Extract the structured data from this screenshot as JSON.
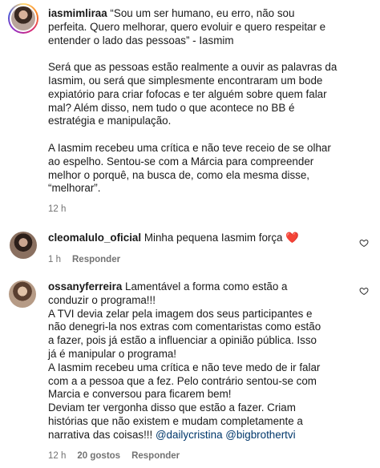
{
  "comments": [
    {
      "username": "iasmimliraa",
      "lines": [
        " “Sou um ser humano, eu erro, não sou",
        "perfeita. Quero melhorar, quero evoluir e quero respeitar e",
        "entender o lado das pessoas” - Iasmim",
        "",
        "Será que as pessoas estão realmente a ouvir as palavras da",
        "Iasmim, ou será que simplesmente encontraram um bode",
        "expiatório para criar fofocas e ter alguém sobre quem falar",
        "mal? Além disso, nem tudo o que acontece no BB é",
        "estratégia e manipulação.",
        "",
        "A Iasmim recebeu uma crítica e não teve receio de se olhar",
        "ao espelho. Sentou-se com a Márcia para compreender",
        "melhor o porquê, na busca de, como ela mesma disse,",
        "“melhorar”."
      ],
      "time": "12 h"
    },
    {
      "username": "cleomalulo_oficial",
      "text": " Minha pequena Iasmim força ",
      "emoji": "❤️",
      "time": "1 h",
      "reply_label": "Responder"
    },
    {
      "username": "ossanyferreira",
      "lines": [
        " Lamentável a forma como estão a",
        "conduzir o programa!!!",
        "A TVI devia zelar pela imagem dos seus participantes e",
        "não denegri-la nos extras com comentaristas como estão",
        "a fazer, pois já estão a influenciar a opinião pública. Isso",
        "já é manipular o programa!",
        "A Iasmim recebeu uma crítica e não teve medo de ir falar",
        "com a a pessoa que a fez. Pelo contrário sentou-se com",
        "Marcia e conversou para ficarem bem!",
        "Deviam ter vergonha disso que estão a fazer. Criam",
        "histórias que não existem e mudam completamente a",
        "narrativa das coisas!!! "
      ],
      "mentions": [
        "@dailycristina",
        "@bigbrothertvi"
      ],
      "time": "12 h",
      "likes": "20 gostos",
      "reply_label": "Responder"
    }
  ],
  "colors": {
    "meta": "#737373",
    "mention": "#00376b",
    "heart": "#e0322f"
  },
  "icons": [
    "heart-outline-icon"
  ]
}
